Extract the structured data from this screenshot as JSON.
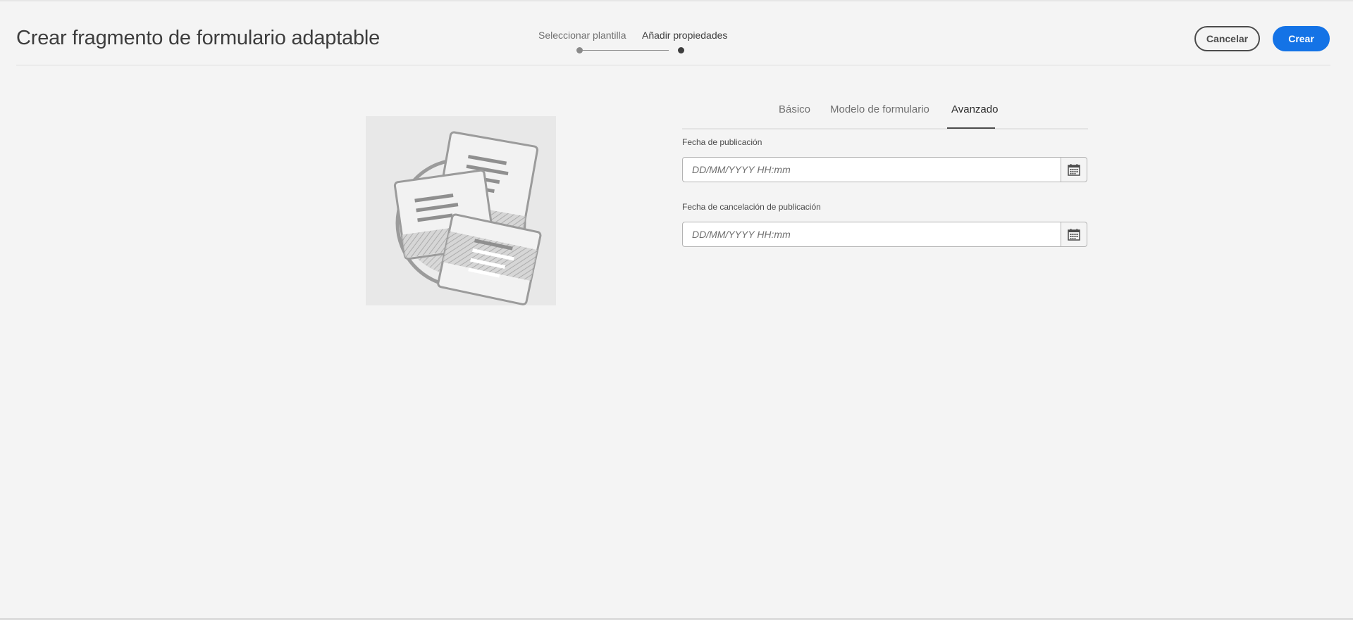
{
  "header": {
    "title": "Crear fragmento de formulario adaptable",
    "cancel_label": "Cancelar",
    "create_label": "Crear"
  },
  "stepper": {
    "steps": [
      {
        "label": "Seleccionar plantilla",
        "state": "completed"
      },
      {
        "label": "Añadir propiedades",
        "state": "current"
      }
    ]
  },
  "tabs": [
    {
      "label": "Básico",
      "selected": false
    },
    {
      "label": "Modelo de formulario",
      "selected": false
    },
    {
      "label": "Avanzado",
      "selected": true
    }
  ],
  "fields": [
    {
      "label": "Fecha de publicación",
      "placeholder": "DD/MM/YYYY HH:mm",
      "value": "",
      "icon": "calendar-icon"
    },
    {
      "label": "Fecha de cancelación de publicación",
      "placeholder": "DD/MM/YYYY HH:mm",
      "value": "",
      "icon": "calendar-icon"
    }
  ],
  "thumbnail": {
    "icon": "form-fragment-illustration"
  },
  "colors": {
    "accent": "#1473e6",
    "background": "#f4f4f4",
    "text": "#2c2c2c"
  }
}
